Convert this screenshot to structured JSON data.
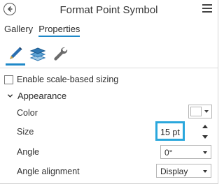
{
  "header": {
    "title": "Format Point Symbol",
    "back_icon": "back-arrow-icon",
    "menu_icon": "hamburger-menu-icon"
  },
  "tabs": [
    {
      "label": "Gallery",
      "active": false
    },
    {
      "label": "Properties",
      "active": true
    }
  ],
  "tools": [
    {
      "icon": "symbol-brush-icon",
      "active": true
    },
    {
      "icon": "layers-icon",
      "active": false
    },
    {
      "icon": "wrench-icon",
      "active": false
    }
  ],
  "scale_sizing": {
    "label": "Enable scale-based sizing",
    "checked": false
  },
  "appearance": {
    "heading": "Appearance",
    "expanded": true,
    "color_label": "Color",
    "color_value": "#ffffff",
    "size_label": "Size",
    "size_value": "15 pt",
    "angle_label": "Angle",
    "angle_value": "0°",
    "angle_alignment_label": "Angle alignment",
    "angle_alignment_value": "Display"
  },
  "colors": {
    "accent": "#1e88c8",
    "highlight": "#2aa7dc"
  }
}
